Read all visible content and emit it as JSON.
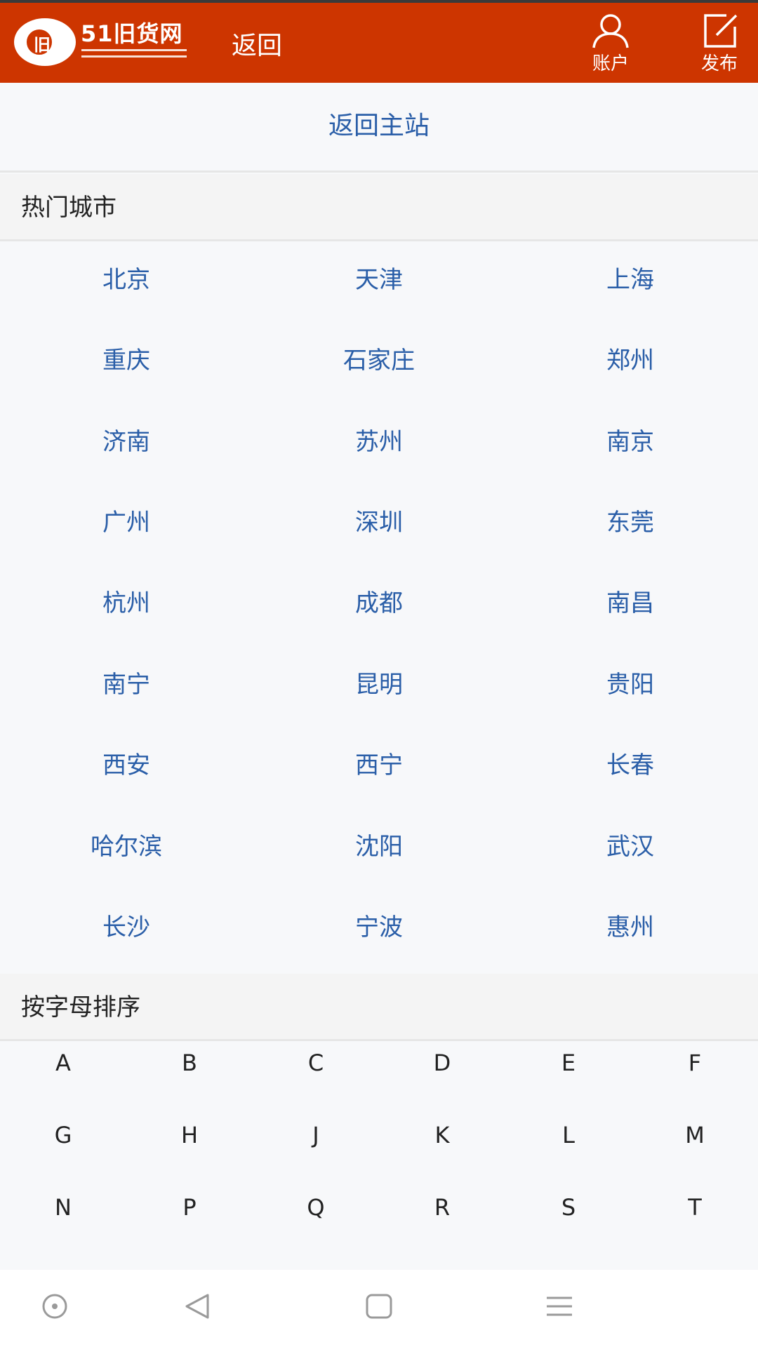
{
  "header": {
    "logo_text": "51旧货网",
    "back_label": "返回",
    "account_label": "账户",
    "publish_label": "发布",
    "brand_color": "#cd3500"
  },
  "main_link": "返回主站",
  "hot_cities": {
    "title": "热门城市",
    "items": [
      "北京",
      "天津",
      "上海",
      "重庆",
      "石家庄",
      "郑州",
      "济南",
      "苏州",
      "南京",
      "广州",
      "深圳",
      "东莞",
      "杭州",
      "成都",
      "南昌",
      "南宁",
      "昆明",
      "贵阳",
      "西安",
      "西宁",
      "长春",
      "哈尔滨",
      "沈阳",
      "武汉",
      "长沙",
      "宁波",
      "惠州"
    ]
  },
  "alphabet": {
    "title": "按字母排序",
    "letters": [
      "A",
      "B",
      "C",
      "D",
      "E",
      "F",
      "G",
      "H",
      "J",
      "K",
      "L",
      "M",
      "N",
      "P",
      "Q",
      "R",
      "S",
      "T"
    ]
  },
  "icons": {
    "account": "user-icon",
    "publish": "edit-icon",
    "nav": [
      "record-icon",
      "back-triangle-icon",
      "home-square-icon",
      "menu-icon"
    ]
  },
  "colors": {
    "link": "#2a5ea8",
    "text": "#222222"
  }
}
